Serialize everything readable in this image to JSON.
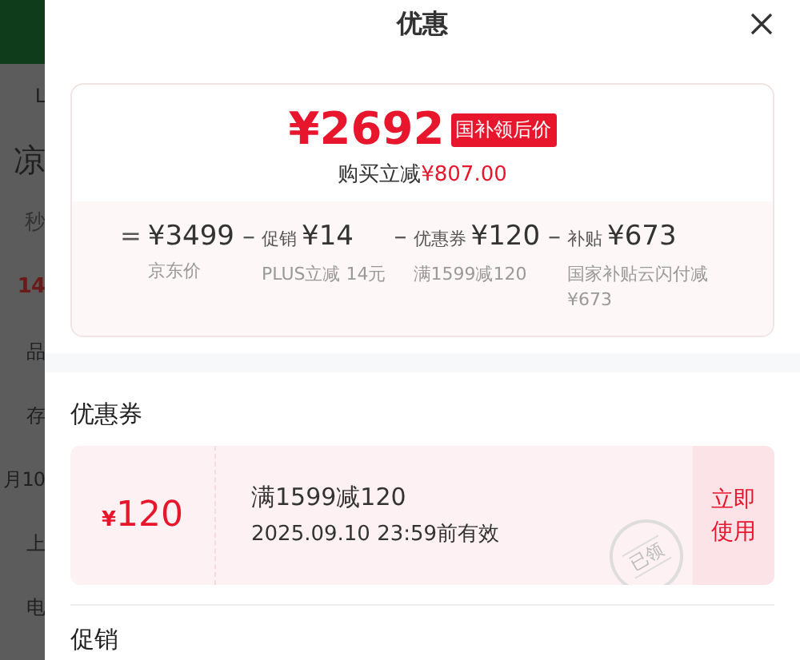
{
  "background_page": {
    "texts": [
      {
        "text": "L",
        "kind": "plain"
      },
      {
        "text": "凉",
        "kind": "title"
      },
      {
        "text": "秒",
        "kind": "muted"
      },
      {
        "text": "14",
        "kind": "accent"
      },
      {
        "text": "品",
        "kind": "plain"
      },
      {
        "text": "存",
        "kind": "plain"
      },
      {
        "text": "月10",
        "kind": "plain"
      },
      {
        "text": "上",
        "kind": "plain"
      },
      {
        "text": "电",
        "kind": "plain"
      }
    ]
  },
  "sheet": {
    "title": "优惠",
    "summary": {
      "price": "¥2692",
      "badge": "国补领后价",
      "saving_label": "购买立减",
      "saving_amount": "¥807.00",
      "breakdown": [
        {
          "op": "=",
          "amount": "¥3499",
          "note": "京东价"
        },
        {
          "op": "–",
          "label": "促销",
          "amount": "¥14",
          "note": "PLUS立减 14元"
        },
        {
          "op": "–",
          "label": "优惠券",
          "amount": "¥120",
          "note": "满1599减120"
        },
        {
          "op": "–",
          "label": "补贴",
          "amount": "¥673",
          "note": "国家补贴云闪付减¥673"
        }
      ]
    },
    "coupons": {
      "title": "优惠券",
      "items": [
        {
          "currency": "¥",
          "value": "120",
          "condition": "满1599减120",
          "validity": "2025.09.10 23:59前有效",
          "stamp": "已领",
          "action": "立即使用"
        }
      ]
    },
    "promotions": {
      "title": "促销"
    }
  }
}
